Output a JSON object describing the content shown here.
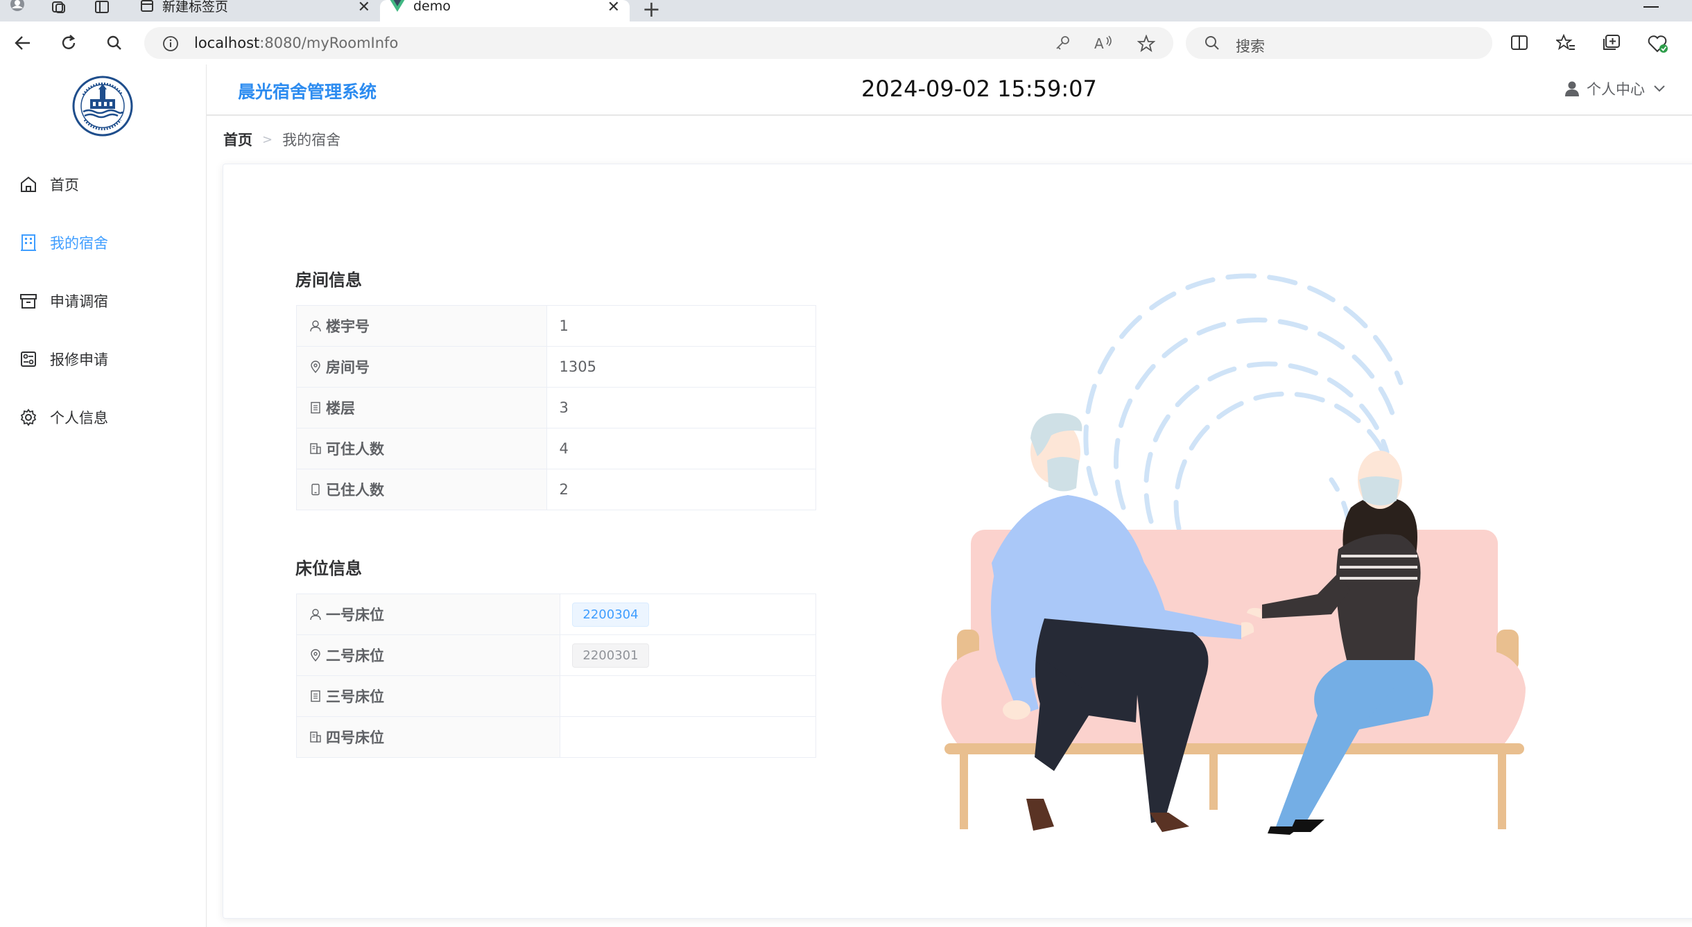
{
  "browser": {
    "tabs": [
      {
        "label": "新建标签页",
        "active": false
      },
      {
        "label": "demo",
        "active": true
      }
    ],
    "url_host": "localhost",
    "url_rest": ":8080/myRoomInfo",
    "search_placeholder": "搜索"
  },
  "app": {
    "title": "晨光宿舍管理系统",
    "clock": "2024-09-02 15:59:07",
    "user_center_label": "个人中心"
  },
  "sidebar": {
    "items": [
      {
        "label": "首页",
        "icon": "home-icon",
        "active": false
      },
      {
        "label": "我的宿舍",
        "icon": "building-icon",
        "active": true
      },
      {
        "label": "申请调宿",
        "icon": "box-icon",
        "active": false
      },
      {
        "label": "报修申请",
        "icon": "repair-form-icon",
        "active": false
      },
      {
        "label": "个人信息",
        "icon": "gear-icon",
        "active": false
      }
    ]
  },
  "breadcrumb": {
    "home": "首页",
    "current": "我的宿舍"
  },
  "room_info": {
    "title": "房间信息",
    "rows": [
      {
        "label": "楼宇号",
        "value": "1",
        "icon": "user-icon"
      },
      {
        "label": "房间号",
        "value": "1305",
        "icon": "location-icon"
      },
      {
        "label": "楼层",
        "value": "3",
        "icon": "document-icon"
      },
      {
        "label": "可住人数",
        "value": "4",
        "icon": "office-icon"
      },
      {
        "label": "已住人数",
        "value": "2",
        "icon": "phone-icon"
      }
    ]
  },
  "bed_info": {
    "title": "床位信息",
    "rows": [
      {
        "label": "一号床位",
        "value": "2200304",
        "icon": "user-icon",
        "tag": "blue"
      },
      {
        "label": "二号床位",
        "value": "2200301",
        "icon": "location-icon",
        "tag": "gray"
      },
      {
        "label": "三号床位",
        "value": "",
        "icon": "document-icon",
        "tag": ""
      },
      {
        "label": "四号床位",
        "value": "",
        "icon": "office-icon",
        "tag": ""
      }
    ]
  },
  "colors": {
    "accent": "#409eff",
    "title_blue": "#2d8cf0"
  }
}
